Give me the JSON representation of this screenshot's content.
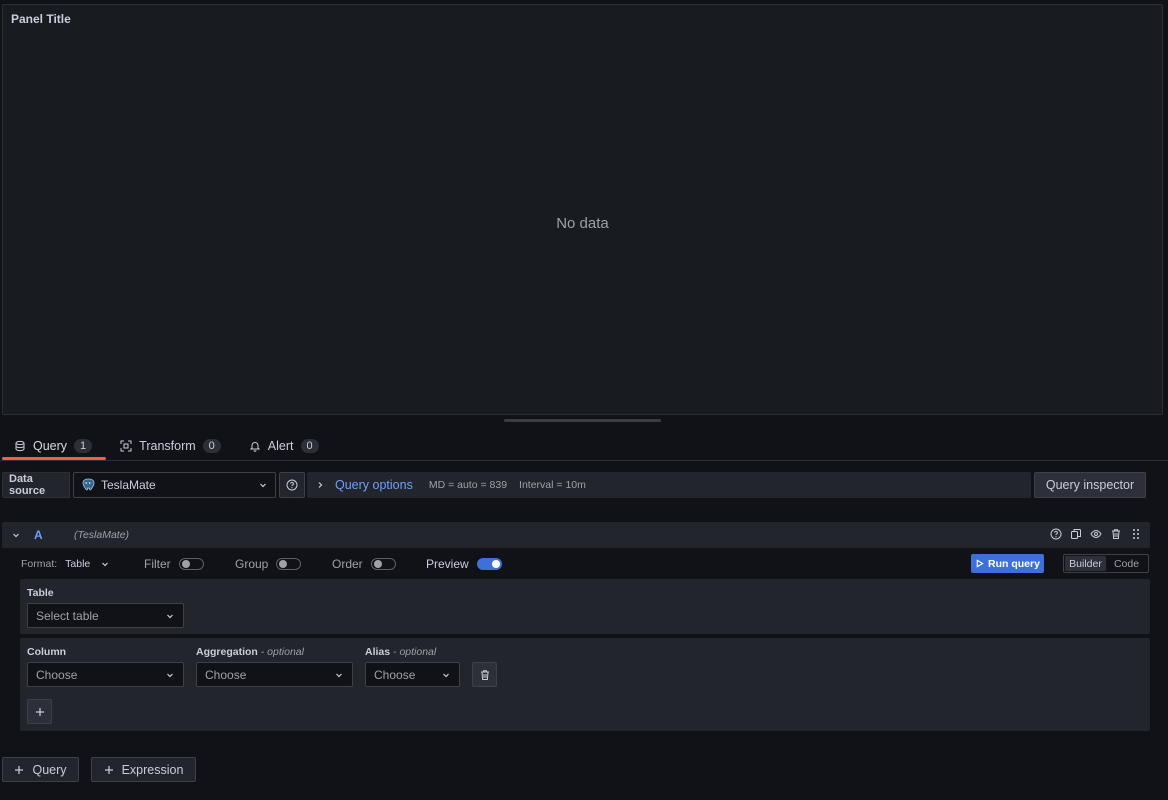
{
  "panel": {
    "title": "Panel Title",
    "no_data": "No data"
  },
  "tabs": [
    {
      "label": "Query",
      "count": "1",
      "icon": "database-icon"
    },
    {
      "label": "Transform",
      "count": "0",
      "icon": "transform-icon"
    },
    {
      "label": "Alert",
      "count": "0",
      "icon": "bell-icon"
    }
  ],
  "datasource": {
    "label": "Data source",
    "selected": "TeslaMate",
    "query_options_label": "Query options",
    "md": "MD = auto = 839",
    "interval": "Interval = 10m",
    "inspector_label": "Query inspector"
  },
  "query": {
    "ref": "A",
    "ds_hint": "(TeslaMate)",
    "format_label": "Format:",
    "format_value": "Table",
    "filter_label": "Filter",
    "group_label": "Group",
    "order_label": "Order",
    "preview_label": "Preview",
    "filter_on": false,
    "group_on": false,
    "order_on": false,
    "preview_on": true,
    "run_label": "Run query",
    "mode_builder": "Builder",
    "mode_code": "Code",
    "table_label": "Table",
    "table_placeholder": "Select table",
    "column_label": "Column",
    "aggregation_label": "Aggregation",
    "alias_label": "Alias",
    "optional_suffix": "- optional",
    "column_value": "Choose",
    "aggregation_value": "Choose",
    "alias_value": "Choose"
  },
  "bottom": {
    "add_query": "Query",
    "add_expression": "Expression"
  },
  "colors": {
    "accent": "#3d71d9",
    "tab_underline": "#f55f3e",
    "link": "#6e9fff"
  }
}
